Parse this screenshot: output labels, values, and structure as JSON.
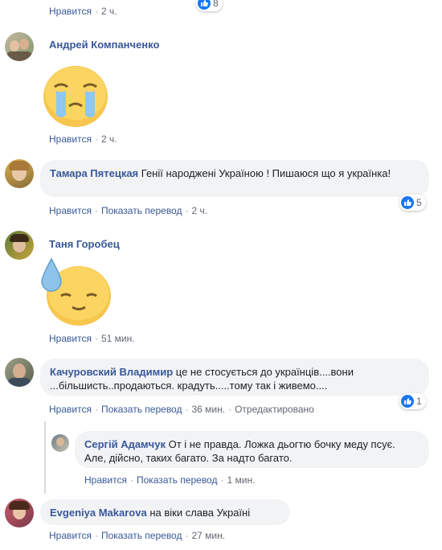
{
  "top_row": {
    "like": "Нравится",
    "time": "2 ч.",
    "reactions": "8"
  },
  "comments": [
    {
      "author": "Андрей Компанченко",
      "like": "Нравится",
      "time": "2 ч."
    },
    {
      "author": "Тамара Пятецкая",
      "text": "Генії народжені Україною ! Пишаюся що я українка!",
      "like": "Нравится",
      "translate": "Показать перевод",
      "time": "2 ч.",
      "reactions": "5"
    },
    {
      "author": "Таня Горобец",
      "like": "Нравится",
      "time": "51 мин."
    },
    {
      "author": "Качуровский Владимир",
      "text": "це не стосується до українців....вони ...більшисть..продаються. крадуть.....тому так і живемо....",
      "like": "Нравится",
      "translate": "Показать перевод",
      "time": "36 мин.",
      "edited": "Отредактировано",
      "reactions": "1"
    },
    {
      "author": "Сергій Адамчук",
      "text": "От і не правда. Ложка дьогтю бочку меду псує. Але, дійсно, таких багато. За надто багато.",
      "like": "Нравится",
      "translate": "Показать перевод",
      "time": "1 мин."
    },
    {
      "author": "Evgeniya Makarova",
      "text": "на віки слава Україні",
      "like": "Нравится",
      "translate": "Показать перевод",
      "time": "27 мин."
    }
  ],
  "colors": {
    "link": "#385898",
    "bubble": "#f2f3f5",
    "like_blue": "#1877f2"
  }
}
